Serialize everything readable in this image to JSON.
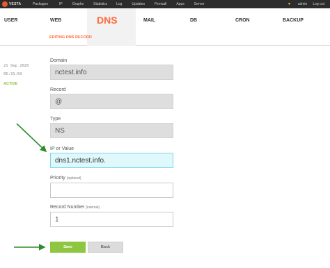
{
  "topbar": {
    "logo_text": "VESTA",
    "menu": [
      "Packages",
      "IP",
      "Graphs",
      "Statistics",
      "Log",
      "Updates",
      "Firewall",
      "Apps",
      "Server"
    ],
    "user": "admin",
    "logout_label": "Log out"
  },
  "nav": {
    "items": [
      "USER",
      "WEB",
      "DNS",
      "MAIL",
      "DB",
      "CRON",
      "BACKUP"
    ],
    "active": "DNS",
    "subtitle": "EDITING DNS RECORD"
  },
  "meta": {
    "date": "21 Sep 2020",
    "time": "05:31:50",
    "status": "ACTIVE"
  },
  "form": {
    "domain_label": "Domain",
    "domain_value": "nctest.info",
    "record_label": "Record",
    "record_value": "@",
    "type_label": "Type",
    "type_value": "NS",
    "ip_label": "IP or Value",
    "ip_value": "dns1.nctest.info.",
    "priority_label": "Priority",
    "priority_hint": "(optional)",
    "priority_value": "",
    "record_number_label": "Record Number",
    "record_number_hint": "(internal)",
    "record_number_value": "1"
  },
  "buttons": {
    "save": "Save",
    "back": "Back"
  },
  "colors": {
    "accent": "#ff6a3d",
    "active": "#8ac53f",
    "save": "#8ec641",
    "arrow": "#2e8b2e",
    "focus_bg": "#dff8fc"
  }
}
